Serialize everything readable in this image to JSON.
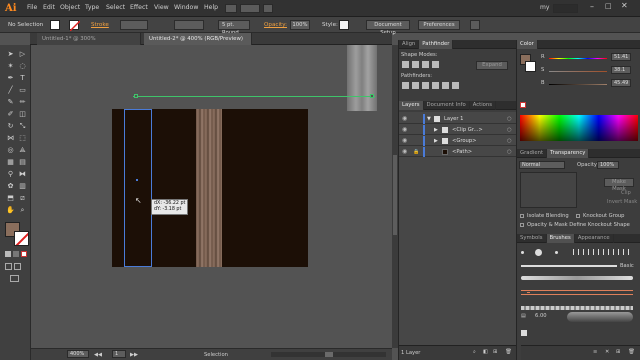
{
  "app": {
    "logo": "Ai",
    "workspace": "my"
  },
  "menubar": {
    "items": [
      "File",
      "Edit",
      "Object",
      "Type",
      "Select",
      "Effect",
      "View",
      "Window",
      "Help"
    ]
  },
  "controlbar": {
    "selection_label": "No Selection",
    "stroke_label": "Stroke",
    "brush_value": "5 pt. Round",
    "opacity_label": "Opacity:",
    "opacity_value": "100%",
    "style_label": "Style:",
    "document_setup": "Document Setup",
    "preferences": "Preferences"
  },
  "tabs": [
    {
      "label": "Untitled-1* @ 300% (RGB/Preview)"
    },
    {
      "label": "Untitled-2* @ 400% (RGB/Preview)"
    }
  ],
  "tooltip": {
    "line1": "dX: -36.22 pt",
    "line2": "dY: -3.18 pt"
  },
  "statusbar": {
    "zoom": "400%",
    "page": "1",
    "tool": "Selection"
  },
  "align_panel": {
    "tabs": [
      "Align",
      "Pathfinder"
    ],
    "shape_modes_label": "Shape Modes:",
    "pathfinders_label": "Pathfinders:",
    "expand_label": "Expand"
  },
  "layers_panel": {
    "tabs": [
      "Layers",
      "Document Info",
      "Actions"
    ],
    "rows": [
      {
        "name": "Layer 1"
      },
      {
        "name": "<Clip Gr...>"
      },
      {
        "name": "<Group>"
      },
      {
        "name": "<Path>"
      }
    ],
    "footer": "1 Layer"
  },
  "color_panel": {
    "tab": "Color",
    "channels": [
      {
        "label": "R",
        "value": "51.41"
      },
      {
        "label": "S",
        "value": "38.1"
      },
      {
        "label": "B",
        "value": "45.49"
      }
    ],
    "accent": "#1c0f06"
  },
  "transparency_panel": {
    "tabs": [
      "Gradient",
      "Transparency"
    ],
    "mode_value": "Normal",
    "opacity_label": "Opacity:",
    "opacity_value": "100%",
    "make_mask": "Make Mask",
    "clip": "Clip",
    "invert_mask": "Invert Mask",
    "isolate_blending": "Isolate Blending",
    "knockout_group": "Knockout Group",
    "opacity_mask_line": "Opacity & Mask Define Knockout Shape"
  },
  "brushes_panel": {
    "tabs": [
      "Symbols",
      "Brushes",
      "Appearance"
    ],
    "basic_label": "Basic",
    "size_label": "6.00"
  }
}
